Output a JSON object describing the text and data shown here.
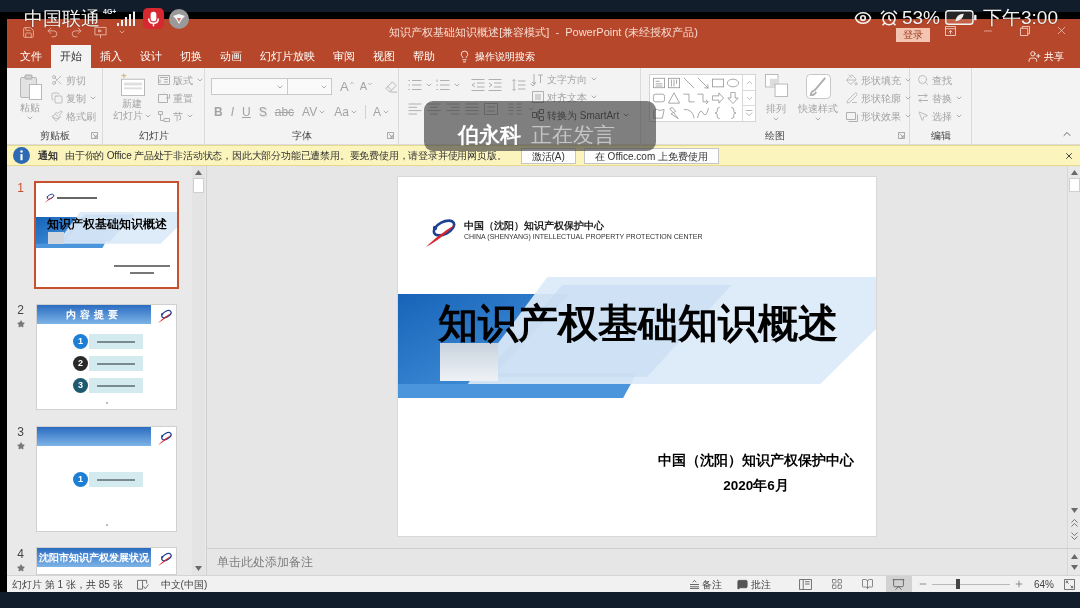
{
  "phone_status": {
    "carrier": "中国联通",
    "network": "4G+",
    "battery": "53%",
    "time": "下午3:00"
  },
  "window": {
    "title": "知识产权基础知识概述[兼容模式]  -  PowerPoint (未经授权产品)",
    "sign_in": "登录"
  },
  "tabs": [
    {
      "label": "文件",
      "selected": false
    },
    {
      "label": "开始",
      "selected": true
    },
    {
      "label": "插入",
      "selected": false
    },
    {
      "label": "设计",
      "selected": false
    },
    {
      "label": "切换",
      "selected": false
    },
    {
      "label": "动画",
      "selected": false
    },
    {
      "label": "幻灯片放映",
      "selected": false
    },
    {
      "label": "审阅",
      "selected": false
    },
    {
      "label": "视图",
      "selected": false
    },
    {
      "label": "帮助",
      "selected": false
    }
  ],
  "tell_me": "操作说明搜索",
  "share": "共享",
  "ribbon": {
    "disabled": true,
    "clipboard": {
      "label": "剪贴板",
      "paste": "粘贴",
      "commands": [
        "剪切",
        "复制",
        "格式刷"
      ]
    },
    "slides": {
      "label": "幻灯片",
      "new_slide": [
        "新建",
        "幻灯片"
      ],
      "commands": [
        "版式",
        "重置",
        "节"
      ]
    },
    "font": {
      "label": "字体",
      "grow": "A",
      "shrink": "A",
      "formats": [
        "B",
        "I",
        "U",
        "S",
        "abc",
        "AV",
        "Aa",
        "A"
      ]
    },
    "paragraph": {
      "commands": [
        "文字方向",
        "对齐文本",
        "转换为 SmartArt"
      ]
    },
    "drawing": {
      "label": "绘图",
      "arrange": "排列",
      "quick_styles": "快速样式",
      "commands": [
        "形状填充",
        "形状轮廓",
        "形状效果"
      ]
    },
    "editing": {
      "label": "编辑",
      "commands": [
        "查找",
        "替换",
        "选择"
      ]
    }
  },
  "speaker_overlay": {
    "name": "伯永科",
    "status": "正在发言"
  },
  "notice": {
    "title": "通知",
    "message": "由于你的 Office 产品处于非活动状态，因此大部分功能已遭禁用。要免费使用，请登录并使用网页版。",
    "buttons": [
      "激活(A)",
      "在 Office.com 上免费使用"
    ]
  },
  "thumbnails": [
    {
      "number": "1",
      "selected": true,
      "animated": false,
      "kind": "title",
      "title": "知识产权基础知识概述"
    },
    {
      "number": "2",
      "selected": false,
      "animated": true,
      "kind": "contents",
      "heading": "内容提要",
      "items": [
        {
          "label": "1",
          "color": "#1b7fd6"
        },
        {
          "label": "2",
          "color": "#2a2a2a"
        },
        {
          "label": "3",
          "color": "#1d5a70"
        }
      ]
    },
    {
      "number": "3",
      "selected": false,
      "animated": true,
      "kind": "section",
      "items": [
        {
          "label": "1",
          "color": "#1b7fd6"
        }
      ]
    },
    {
      "number": "4",
      "selected": false,
      "animated": true,
      "kind": "content",
      "heading": "沈阳市知识产权发展状况"
    }
  ],
  "slide": {
    "org": "中国（沈阳）知识产权保护中心",
    "org_en": "CHINA (SHENYANG) INTELLECTUAL PROPERTY PROTECTION CENTER",
    "title": "知识产权基础知识概述",
    "presenter": "中国（沈阳）知识产权保护中心",
    "date": "2020年6月"
  },
  "notes": {
    "placeholder": "单击此处添加备注"
  },
  "status_bar": {
    "slide_info": "幻灯片 第 1 张，共 85 张",
    "language": "中文(中国)",
    "notes": "备注",
    "comments": "批注",
    "views": [
      {
        "kind": "normal",
        "selected": false
      },
      {
        "kind": "sorter",
        "selected": false
      },
      {
        "kind": "reading",
        "selected": false
      },
      {
        "kind": "slideshow",
        "selected": true
      }
    ],
    "zoom": {
      "level": 0.33,
      "reading": "64%"
    }
  }
}
